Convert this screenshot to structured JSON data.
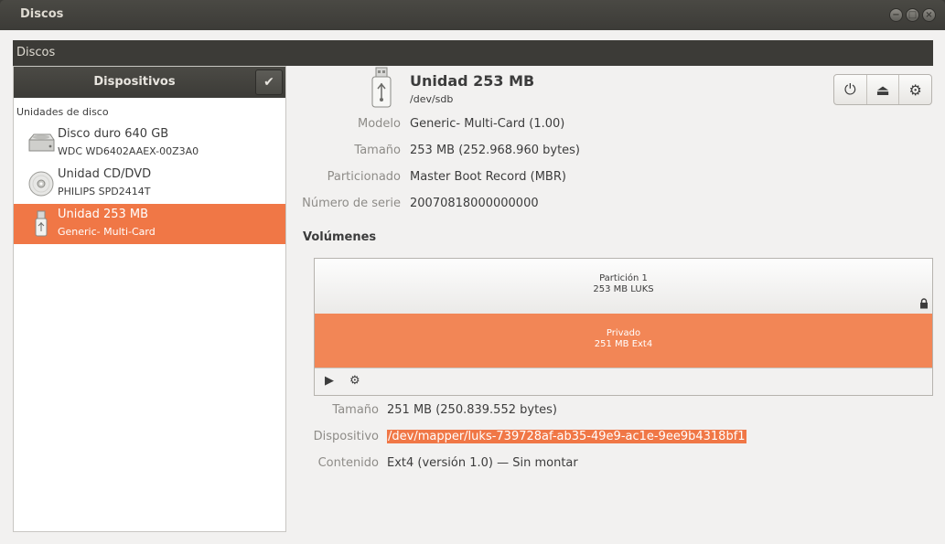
{
  "window": {
    "title": "Discos",
    "controls": [
      "−",
      "□",
      "×"
    ]
  },
  "app": {
    "toolbar_label": "Discos"
  },
  "sidebar": {
    "header": "Dispositivos",
    "check_icon": "✔",
    "group_label": "Unidades de disco",
    "devices": [
      {
        "name": "Disco duro 640 GB",
        "sub": "WDC WD6402AAEX-00Z3A0",
        "icon": "harddisk-icon"
      },
      {
        "name": "Unidad CD/DVD",
        "sub": "PHILIPS SPD2414T",
        "icon": "optical-disc-icon"
      },
      {
        "name": "Unidad 253 MB",
        "sub": "Generic- Multi-Card",
        "icon": "usb-drive-icon",
        "selected": true
      }
    ]
  },
  "drive": {
    "title": "Unidad 253 MB",
    "path": "/dev/sdb",
    "props": [
      {
        "k": "Modelo",
        "v": "Generic- Multi-Card (1.00)"
      },
      {
        "k": "Tamaño",
        "v": "253 MB (252.968.960 bytes)"
      },
      {
        "k": "Particionado",
        "v": "Master Boot Record (MBR)"
      },
      {
        "k": "Número de serie",
        "v": "20070818000000000"
      }
    ]
  },
  "toolbar": {
    "power_icon": "⏻",
    "eject_icon": "⏏",
    "settings_icon": "⚙"
  },
  "volumes": {
    "title": "Volúmenes",
    "partition": {
      "line1": "Partición 1",
      "line2": "253 MB LUKS"
    },
    "inner": {
      "line1": "Privado",
      "line2": "251 MB Ext4"
    },
    "play_icon": "▶",
    "gears_icon": "⚙",
    "props": [
      {
        "k": "Tamaño",
        "v": "251 MB (250.839.552 bytes)"
      },
      {
        "k": "Dispositivo",
        "v": "/dev/mapper/luks-739728af-ab35-49e9-ac1e-9ee9b4318bf1"
      },
      {
        "k": "Contenido",
        "v": "Ext4 (versión 1.0) — Sin montar"
      }
    ]
  },
  "colors": {
    "accent": "#f07746",
    "header": "#3c3b37"
  }
}
